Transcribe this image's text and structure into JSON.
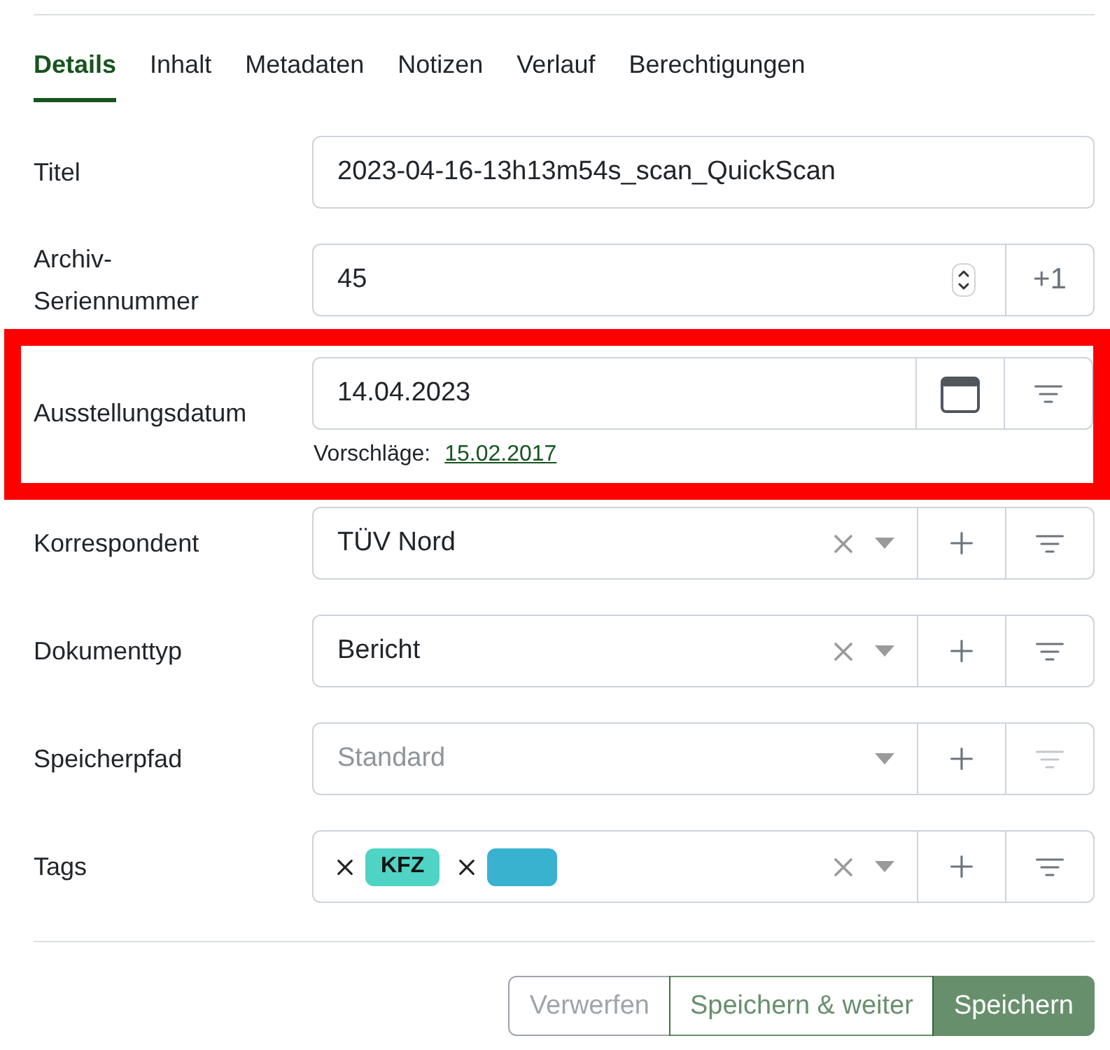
{
  "tabs": [
    {
      "label": "Details",
      "selected": true
    },
    {
      "label": "Inhalt",
      "selected": false
    },
    {
      "label": "Metadaten",
      "selected": false
    },
    {
      "label": "Notizen",
      "selected": false
    },
    {
      "label": "Verlauf",
      "selected": false
    },
    {
      "label": "Berechtigungen",
      "selected": false
    }
  ],
  "fields": [
    {
      "kind": "text",
      "label": "Titel",
      "value": "2023-04-16-13h13m54s_scan_QuickScan",
      "highlighted": false
    },
    {
      "kind": "number",
      "label": "Archiv-Seriennummer",
      "value": "45",
      "button": "+1",
      "highlighted": false
    },
    {
      "kind": "date",
      "label": "Ausstellungsdatum",
      "value": "14.04.2023",
      "highlighted": true,
      "filter_disabled": false,
      "suggestion_label": "Vorschläge:",
      "suggestions": [
        "15.02.2017"
      ]
    },
    {
      "kind": "select",
      "label": "Korrespondent",
      "value": "TÜV Nord",
      "clear": true,
      "filter_disabled": false,
      "highlighted": false
    },
    {
      "kind": "select",
      "label": "Dokumenttyp",
      "value": "Bericht",
      "clear": true,
      "filter_disabled": false,
      "highlighted": false
    },
    {
      "kind": "select",
      "label": "Speicherpfad",
      "placeholder": "Standard",
      "clear": false,
      "filter_disabled": true,
      "highlighted": false
    },
    {
      "kind": "tags",
      "label": "Tags",
      "tags": [
        {
          "label": "KFZ",
          "color": "#4fd3c4"
        },
        {
          "color": "#38b2cf"
        }
      ],
      "clear": true,
      "filter_disabled": false,
      "highlighted": false
    }
  ],
  "footer_buttons": [
    {
      "label": "Verwerfen",
      "kind": "secondary",
      "disabled": true
    },
    {
      "label": "Speichern & weiter",
      "kind": "outline",
      "disabled": true
    },
    {
      "label": "Speichern",
      "kind": "primary",
      "disabled": true
    }
  ]
}
